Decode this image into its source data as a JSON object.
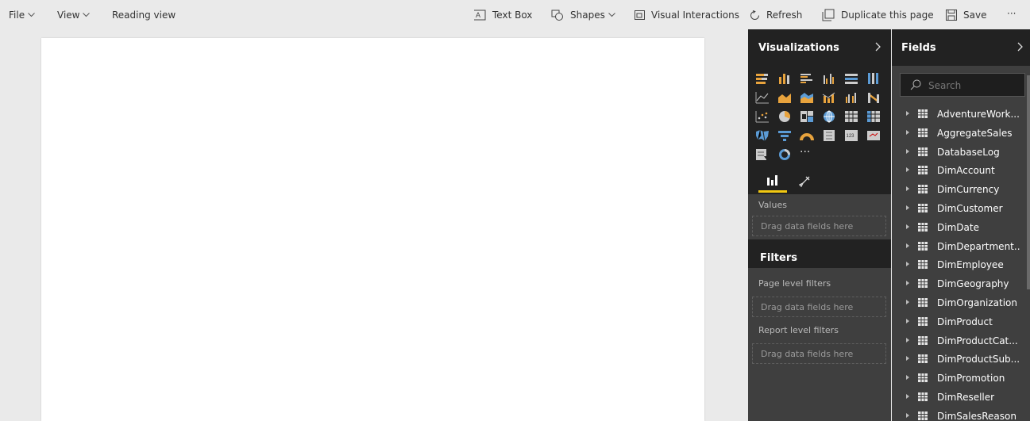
{
  "toolbar": {
    "file": "File",
    "view": "View",
    "reading_view": "Reading view",
    "text_box": "Text Box",
    "shapes": "Shapes",
    "visual_interactions": "Visual Interactions",
    "refresh": "Refresh",
    "duplicate_page": "Duplicate this page",
    "save": "Save",
    "more": "···"
  },
  "visualizations": {
    "title": "Visualizations",
    "more_visuals": "···",
    "values_label": "Values",
    "values_drop": "Drag data fields here"
  },
  "filters": {
    "title": "Filters",
    "page_label": "Page level filters",
    "page_drop": "Drag data fields here",
    "report_label": "Report level filters",
    "report_drop": "Drag data fields here"
  },
  "fields": {
    "title": "Fields",
    "search_placeholder": "Search",
    "items": [
      "AdventureWork...",
      "AggregateSales",
      "DatabaseLog",
      "DimAccount",
      "DimCurrency",
      "DimCustomer",
      "DimDate",
      "DimDepartment..",
      "DimEmployee",
      "DimGeography",
      "DimOrganization",
      "DimProduct",
      "DimProductCat...",
      "DimProductSub...",
      "DimPromotion",
      "DimReseller",
      "DimSalesReason"
    ]
  },
  "colors": {
    "accent": "#f2c811",
    "icon_orange": "#e8a33d",
    "pane_dark": "#222222",
    "pane_mid": "#3f3f3f"
  }
}
